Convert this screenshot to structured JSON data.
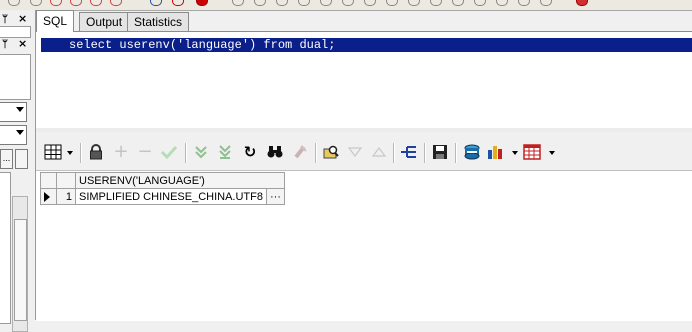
{
  "tabs": [
    {
      "label": "SQL",
      "active": true
    },
    {
      "label": "Output",
      "active": false
    },
    {
      "label": "Statistics",
      "active": false
    }
  ],
  "editor": {
    "sql": "select userenv('language') from dual;"
  },
  "results": {
    "columns": [
      "USERENV('LANGUAGE')"
    ],
    "rows": [
      {
        "num": "1",
        "cells": [
          "SIMPLIFIED CHINESE_CHINA.UTF8"
        ],
        "ellipsis": "···"
      }
    ]
  },
  "left_panel": {
    "pin_glyph": "ᛘ",
    "close_glyph": "×",
    "button_glyph": "..."
  },
  "toolbar_icons": [
    "grid-view-icon",
    "lock-icon",
    "add-record-icon",
    "delete-record-icon",
    "post-changes-icon",
    "fetch-next-icon",
    "fetch-last-icon",
    "refresh-icon",
    "find-icon",
    "clear-record-icon",
    "query-by-example-icon",
    "sort-down-icon",
    "sort-up-icon",
    "tree-icon",
    "save-icon",
    "export-icon",
    "chart-icon",
    "table-icon"
  ],
  "colors": {
    "selection": "#0a1f8a",
    "accent_red": "#c00000",
    "accent_blue": "#2050a0"
  }
}
